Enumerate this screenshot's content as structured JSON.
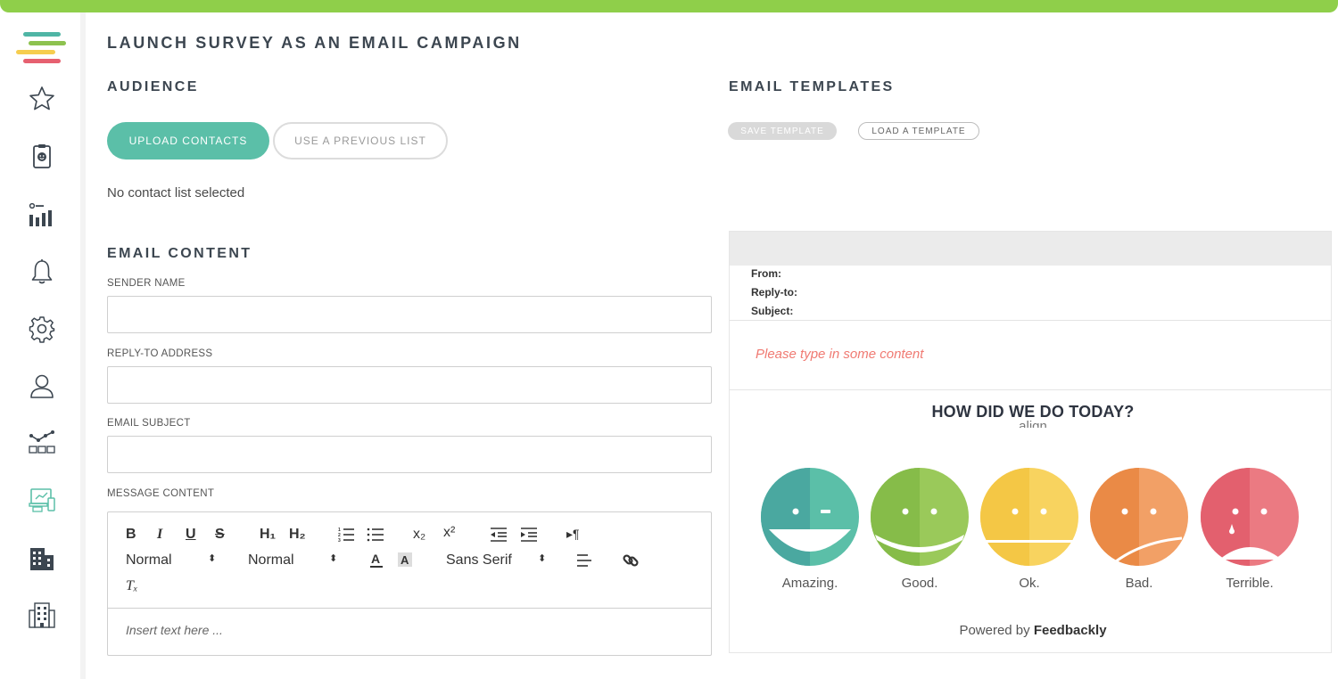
{
  "colors": {
    "topbar": "#8fcf4a",
    "accent": "#5bbfa8",
    "error_text": "#f07a72"
  },
  "sidebar": {
    "logo": "feedbackly-stripes-logo",
    "items": [
      {
        "icon": "star-icon"
      },
      {
        "icon": "clipboard-face-icon"
      },
      {
        "icon": "bar-chart-icon"
      },
      {
        "icon": "bell-icon"
      },
      {
        "icon": "gear-icon"
      },
      {
        "icon": "user-icon"
      },
      {
        "icon": "trend-network-icon"
      },
      {
        "icon": "devices-icon",
        "active": true
      },
      {
        "icon": "building-icon"
      },
      {
        "icon": "buildings-icon"
      }
    ]
  },
  "page": {
    "title": "LAUNCH SURVEY AS AN EMAIL CAMPAIGN"
  },
  "audience": {
    "title": "AUDIENCE",
    "upload_label": "UPLOAD CONTACTS",
    "previous_label": "USE A PREVIOUS LIST",
    "status": "No contact list selected"
  },
  "content": {
    "title": "EMAIL CONTENT",
    "sender_label": "SENDER NAME",
    "sender_value": "",
    "reply_label": "REPLY-TO ADDRESS",
    "reply_value": "",
    "subject_label": "EMAIL SUBJECT",
    "subject_value": "",
    "message_label": "MESSAGE CONTENT",
    "editor": {
      "bold": "B",
      "italic": "I",
      "underline": "U",
      "strike": "S",
      "h1": "H₁",
      "h2": "H₂",
      "sub": "x₂",
      "sup": "x²",
      "rtl": "▸¶",
      "size_select": "Normal",
      "header_select": "Normal",
      "font_select": "Sans Serif",
      "clear_format": "Tₓ",
      "placeholder": "Insert text here ..."
    }
  },
  "templates": {
    "title": "EMAIL TEMPLATES",
    "save_label": "SAVE TEMPLATE",
    "load_label": "LOAD A TEMPLATE"
  },
  "preview": {
    "from_label": "From:",
    "reply_label": "Reply-to:",
    "subject_label": "Subject:",
    "placeholder": "Please type in some content",
    "question": "HOW DID WE DO TODAY?",
    "question_ghost": "align",
    "faces": [
      {
        "label": "Amazing.",
        "color": "#4fb5a5"
      },
      {
        "label": "Good.",
        "color": "#8dc24f"
      },
      {
        "label": "Ok.",
        "color": "#f6cd4f"
      },
      {
        "label": "Bad.",
        "color": "#ee9148"
      },
      {
        "label": "Terrible.",
        "color": "#e66070"
      }
    ],
    "powered_prefix": "Powered by",
    "powered_brand": "Feedbackly"
  }
}
